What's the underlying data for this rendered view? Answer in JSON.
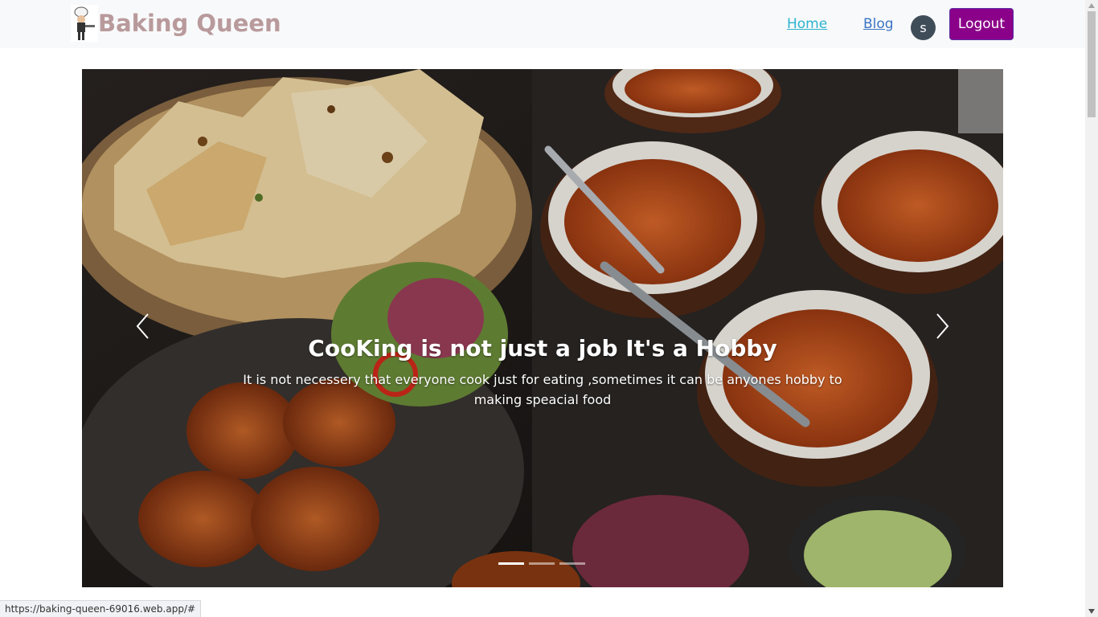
{
  "app": {
    "brand_name": "Baking Queen"
  },
  "nav": {
    "home_label": "Home",
    "blog_label": "Blog",
    "avatar_initial": "s",
    "logout_label": "Logout"
  },
  "carousel": {
    "title": "CooKing is not just a job It's a Hobby",
    "text": "It is not necessery that everyone cook just for eating ,sometimes it can be anyones hobby to making speacial food",
    "prev_icon": "chevron-left-icon",
    "next_icon": "chevron-right-icon",
    "slide_count": 3,
    "active_slide": 1
  },
  "status_bar": {
    "url": "https://baking-queen-69016.web.app/#"
  },
  "colors": {
    "brand_text": "#b99a9c",
    "home_link": "#2cb3cf",
    "blog_link": "#3a74c4",
    "avatar_bg": "#3f4d59",
    "logout_bg": "#8b0089",
    "navbar_bg": "#f8f9fa"
  }
}
